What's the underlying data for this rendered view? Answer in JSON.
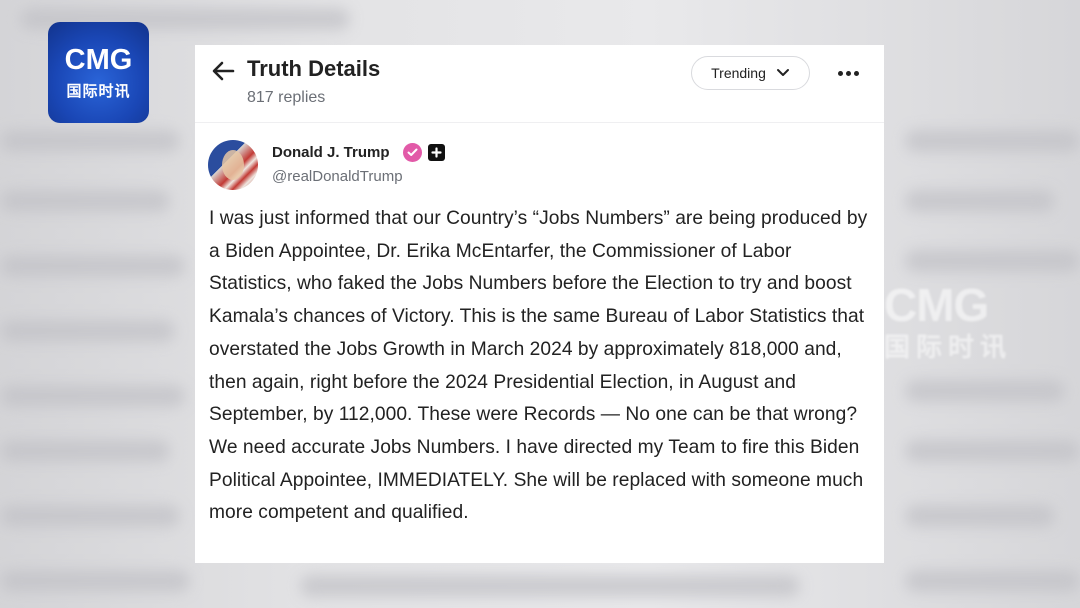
{
  "watermark": {
    "logo_text": "CMG",
    "logo_subtext": "国际时讯",
    "bg_text": "CMG",
    "bg_subtext": "国际时讯"
  },
  "header": {
    "title": "Truth Details",
    "reply_count": "817 replies",
    "sort_label": "Trending",
    "back_icon": "arrow-left-icon",
    "more_icon": "ellipsis-icon"
  },
  "post": {
    "author_name": "Donald J. Trump",
    "handle": "@realDonaldTrump",
    "verified_color": "#e25aa8",
    "body": "I was just informed that our Country’s “Jobs Numbers” are being produced by a Biden Appointee, Dr. Erika McEntarfer, the Commissioner of Labor Statistics, who faked the Jobs Numbers before the Election to try and boost Kamala’s chances of Victory. This is the same Bureau of Labor Statistics that overstated the Jobs Growth in March 2024 by approximately 818,000 and, then again, right before the 2024 Presidential Election, in August and September, by 112,000. These were Records — No one can be that wrong? We need accurate Jobs Numbers. I have directed my Team to fire this Biden Political Appointee, IMMEDIATELY. She will be replaced with someone much more competent and qualified."
  }
}
